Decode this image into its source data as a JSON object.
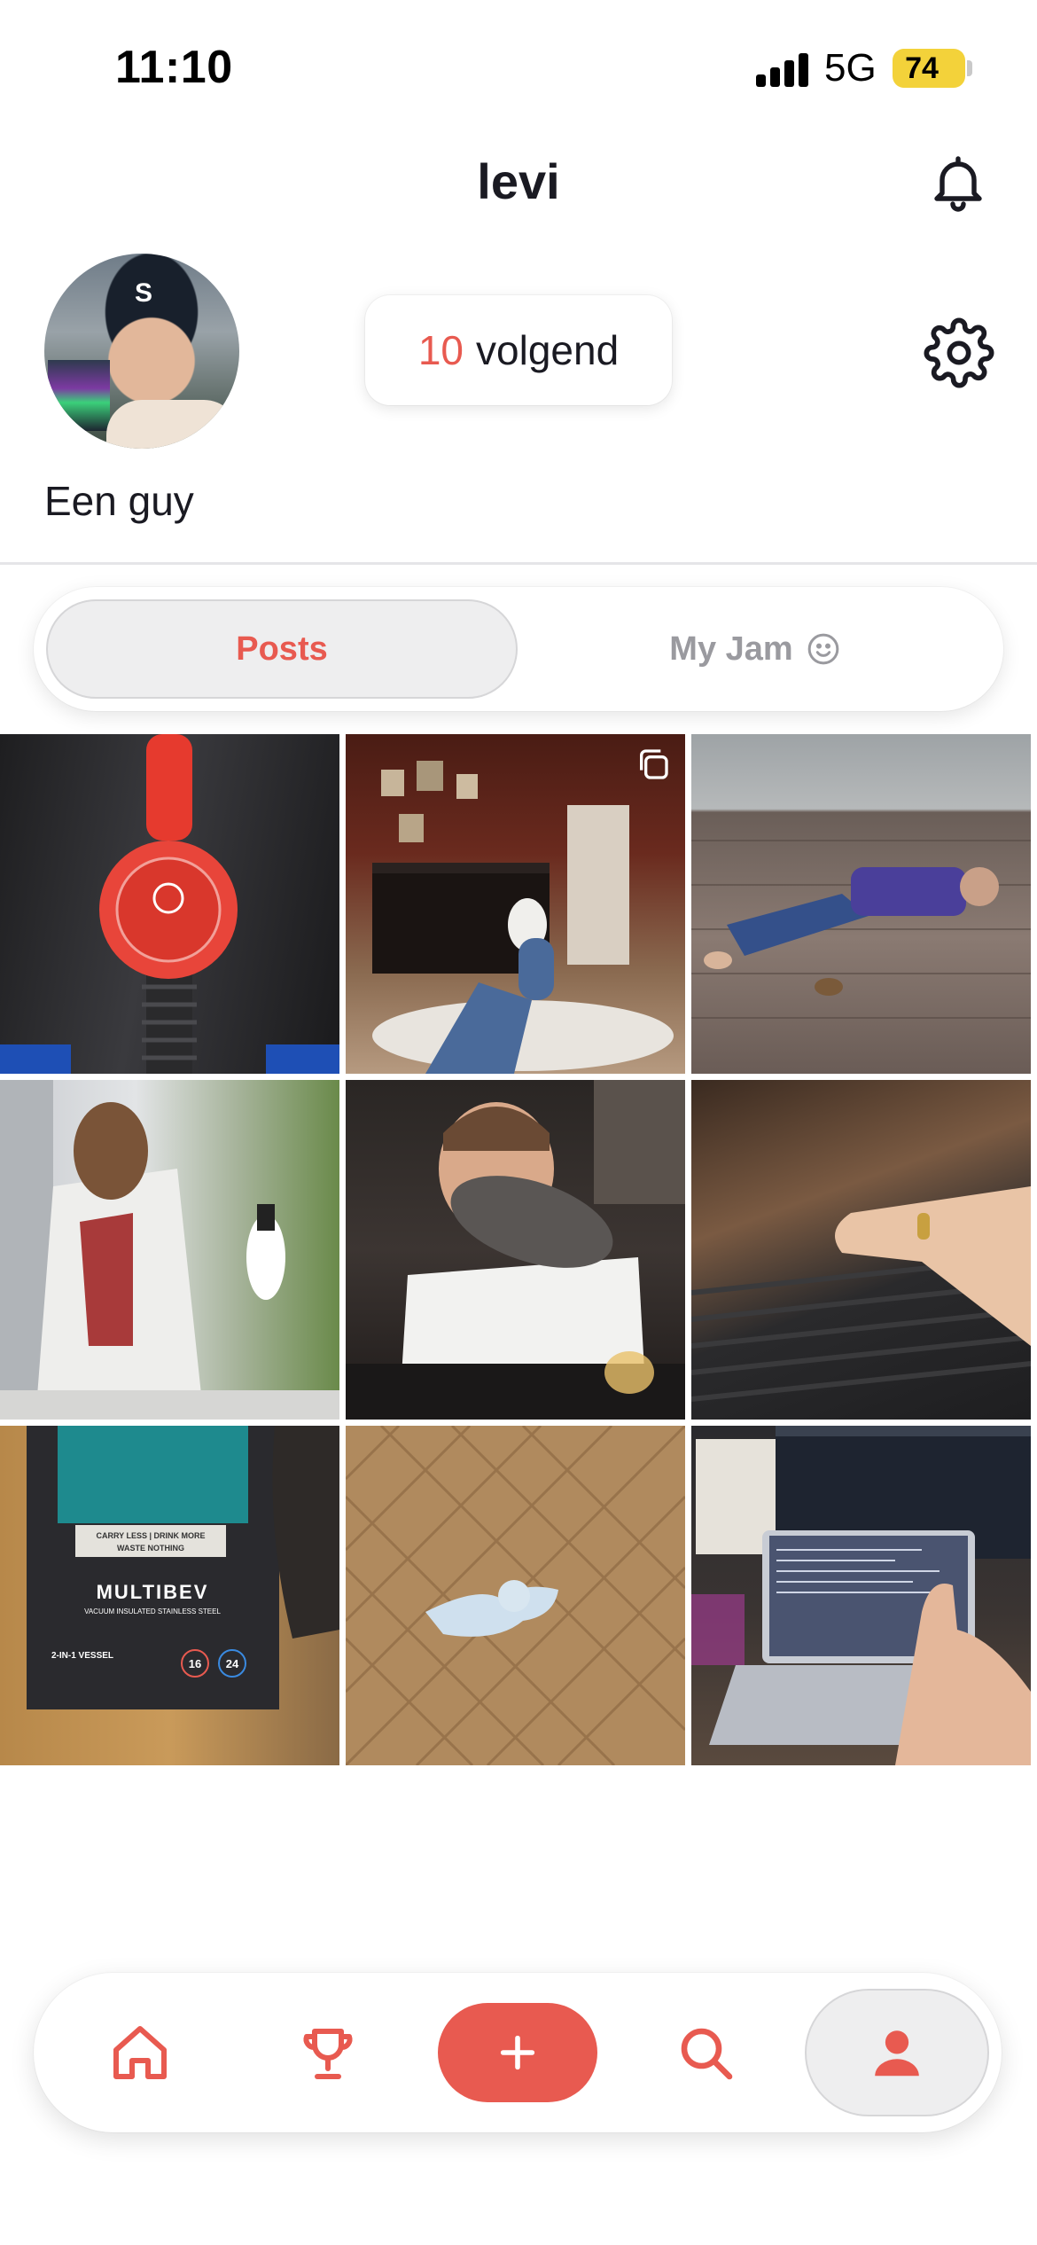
{
  "status_bar": {
    "time": "11:10",
    "network": "5G",
    "battery": "74"
  },
  "header": {
    "username": "levi"
  },
  "profile": {
    "following_count": "10",
    "following_label": "volgend",
    "bio": "Een guy"
  },
  "tabs": [
    {
      "label": "Posts",
      "selected": true
    },
    {
      "label": "My Jam",
      "selected": false
    }
  ],
  "posts": [
    {
      "id": 1,
      "subject": "red Supreme bottle cap",
      "multi": false
    },
    {
      "id": 2,
      "subject": "living room with piano",
      "multi": true
    },
    {
      "id": 3,
      "subject": "person lying on rooftop",
      "multi": false
    },
    {
      "id": 4,
      "subject": "man holding bottle",
      "multi": false
    },
    {
      "id": 5,
      "subject": "man biting hat",
      "multi": false
    },
    {
      "id": 6,
      "subject": "hand with ring",
      "multi": false
    },
    {
      "id": 7,
      "subject": "MULTIBEV box",
      "multi": false,
      "text": [
        "CARRY LESS | DRINK MORE",
        "WASTE NOTHING",
        "MULTIBEV",
        "VACUUM INSULATED STAINLESS STEEL",
        "2-IN-1 VESSEL",
        "16",
        "24"
      ]
    },
    {
      "id": 8,
      "subject": "plush toy on parquet floor",
      "multi": false
    },
    {
      "id": 9,
      "subject": "thumbs up at laptop",
      "multi": false
    }
  ],
  "nav": [
    "home-icon",
    "trophy-icon",
    "plus-icon",
    "search-icon",
    "profile-icon"
  ],
  "colors": {
    "accent": "#e85a50",
    "battery": "#f3d23a",
    "tab_bg": "#eeeeef"
  }
}
